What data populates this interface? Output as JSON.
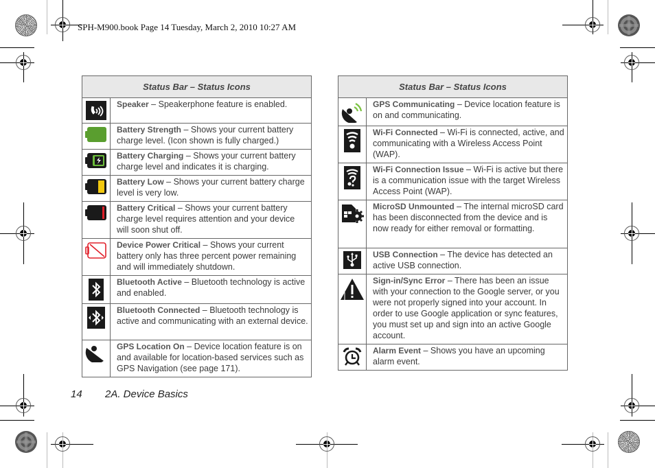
{
  "print_header": "SPH-M900.book  Page 14  Tuesday, March 2, 2010  10:27 AM",
  "left_table": {
    "title": "Status Bar – Status Icons",
    "rows": [
      {
        "icon": "speaker-icon",
        "term": "Speaker",
        "text": " – Speakerphone feature is enabled."
      },
      {
        "icon": "battery-full-icon",
        "term": "Battery Strength",
        "text": " – Shows your current battery charge level. (Icon shown is fully charged.)"
      },
      {
        "icon": "battery-charging-icon",
        "term": "Battery Charging",
        "text": " – Shows your current battery charge level and indicates it is charging."
      },
      {
        "icon": "battery-low-icon",
        "term": "Battery Low",
        "text": " – Shows your current battery charge level is very low."
      },
      {
        "icon": "battery-critical-icon",
        "term": "Battery Critical",
        "text": " – Shows your current battery charge level requires attention and your device will soon shut off."
      },
      {
        "icon": "device-power-critical-icon",
        "term": "Device Power Critical",
        "text": " – Shows your current battery only has three percent power remaining and will immediately shutdown."
      },
      {
        "icon": "bluetooth-active-icon",
        "term": "Bluetooth Active",
        "text": " – Bluetooth technology is active and enabled."
      },
      {
        "icon": "bluetooth-connected-icon",
        "term": "Bluetooth Connected",
        "text": " – Bluetooth technology is active and communicating with an external device."
      },
      {
        "icon": "gps-location-icon",
        "term": "GPS Location On",
        "text": " – Device location feature is on and available for location-based services such as GPS Navigation (see page 171)."
      }
    ]
  },
  "right_table": {
    "title": "Status Bar – Status Icons",
    "rows": [
      {
        "icon": "gps-communicating-icon",
        "term": "GPS Communicating",
        "text": " – Device location feature is on and communicating."
      },
      {
        "icon": "wifi-connected-icon",
        "term": "Wi-Fi Connected",
        "text": " – Wi-Fi is connected, active, and communicating with a Wireless Access Point (WAP)."
      },
      {
        "icon": "wifi-issue-icon",
        "term": "Wi-Fi Connection Issue",
        "text": " – Wi-Fi is active but there is a communication issue with the target Wireless Access Point (WAP)."
      },
      {
        "icon": "microsd-unmounted-icon",
        "term": "MicroSD Unmounted",
        "text": " – The internal microSD card has been disconnected from the device and is now ready for either removal or formatting."
      },
      {
        "icon": "usb-icon",
        "term": "USB Connection",
        "text": " – The device has detected an active USB connection."
      },
      {
        "icon": "warning-icon",
        "term": "Sign-in/Sync Error",
        "text": " – There has been an issue with your connection to the Google server, or you were not properly signed into your account. In order to use Google application or sync features, you must set up and sign into an active Google account."
      },
      {
        "icon": "alarm-icon",
        "term": "Alarm Event",
        "text": " – Shows you have an upcoming alarm event."
      }
    ]
  },
  "footer": {
    "page_number": "14",
    "section": "2A. Device Basics"
  },
  "colors": {
    "battery_green": "#5a9e2f",
    "battery_yellow": "#f2c80f",
    "battery_red": "#e0202a",
    "gps_green": "#7cc242",
    "header_bg": "#e8e8e8"
  }
}
